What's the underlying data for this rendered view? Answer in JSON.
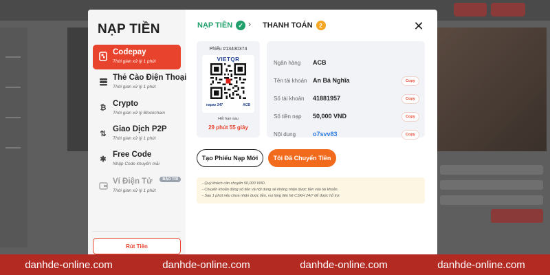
{
  "modal": {
    "title": "NẠP TIỀN",
    "steps": [
      {
        "label": "NẠP TIỀN",
        "state": "done"
      },
      {
        "label": "THANH TOÁN",
        "number": "2"
      }
    ]
  },
  "sidebar": {
    "items": [
      {
        "label": "Codepay",
        "sub": "Thời gian xử lý 1 phút",
        "icon": "qr-phone-icon",
        "active": true
      },
      {
        "label": "Thẻ Cào Điện Thoại",
        "sub": "Thời gian xử lý 1 phút",
        "icon": "card-stack-icon"
      },
      {
        "label": "Crypto",
        "sub": "Thời gian xử lý Blockchain",
        "icon": "bitcoin-icon"
      },
      {
        "label": "Giao Dịch P2P",
        "sub": "Thời gian xử lý 1 phút",
        "icon": "transfer-icon"
      },
      {
        "label": "Free Code",
        "sub": "Nhập Code khuyến mãi",
        "icon": "gift-code-icon"
      },
      {
        "label": "Ví Điện Tử",
        "sub": "Thời gian xử lý 1 phút",
        "icon": "wallet-icon",
        "badge": "BẢO TRÌ",
        "disabled": true
      }
    ],
    "withdraw_label": "Rút Tiền"
  },
  "ticket": {
    "code": "Phiếu #13430374",
    "bank_logo": "VIETQR",
    "qr_footer_left": "napas 247",
    "qr_footer_right": "ACB",
    "expire_label": "Hết hạn sau",
    "expire_time": "29 phút 55 giây"
  },
  "details": {
    "rows": [
      {
        "label": "Ngân hàng",
        "value": "ACB",
        "copy": false
      },
      {
        "label": "Tên tài khoản",
        "value": "An Bá Nghĩa",
        "copy": true
      },
      {
        "label": "Số tài khoản",
        "value": "41881957",
        "copy": true
      },
      {
        "label": "Số tiền nạp",
        "value": "50,000 VND",
        "copy": true
      },
      {
        "label": "Nội dung",
        "value": "o7svv83",
        "copy": true
      }
    ],
    "copy_label": "Copy"
  },
  "actions": {
    "new_ticket": "Tạo Phiếu Nạp Mới",
    "done": "Tôi Đã Chuyển Tiền"
  },
  "notes": [
    "Quý khách cần chuyển 50,000 VND.",
    "Chuyển khoản đúng số tiền và nội dung sẽ không nhận được tiền vào tài khoản.",
    "Sau 1 phút nếu chưa nhận được tiền, vui lòng liên hệ CSKH 24/7 để được hỗ trợ."
  ],
  "footer": {
    "watermarks": [
      "danhde-online.com",
      "danhde-online.com",
      "danhde-online.com",
      "danhde-online.com"
    ]
  },
  "colors": {
    "accent": "#e8432c",
    "success": "#22a06b",
    "primary_button": "#f26a1b",
    "footer": "#b32a22"
  }
}
